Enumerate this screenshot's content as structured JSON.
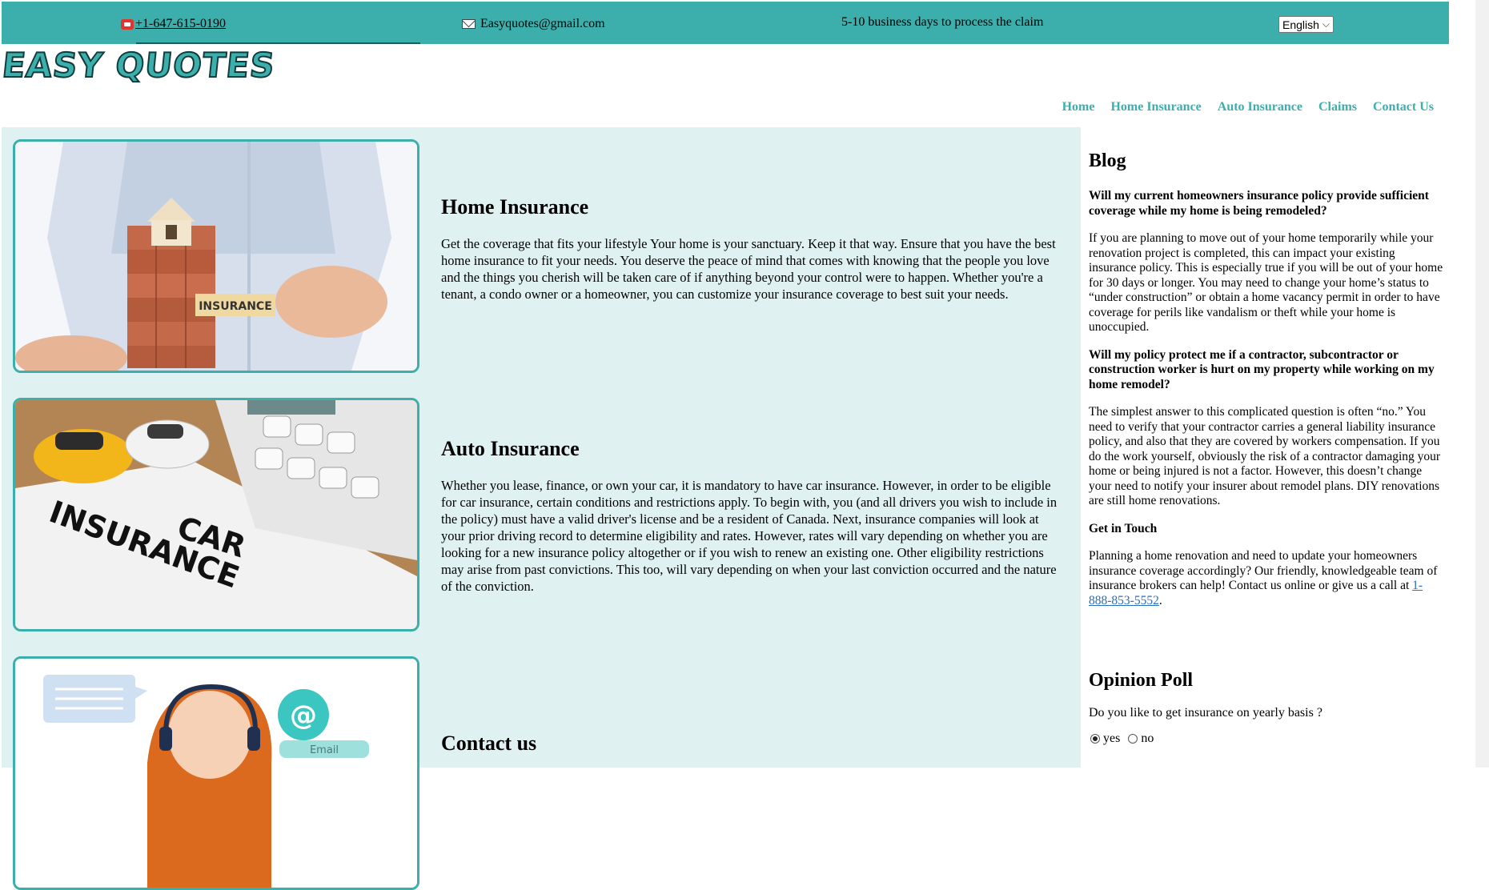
{
  "topbar": {
    "phone": "+1-647-615-0190",
    "email": "Easyquotes@gmail.com",
    "process_note": "5-10 business days to process the claim",
    "language_selected": "English",
    "background_color": "#3cafac"
  },
  "logo": {
    "text": "EASY QUOTES"
  },
  "nav": {
    "items": [
      "Home",
      "Home Insurance",
      "Auto Insurance",
      "Claims",
      "Contact Us"
    ],
    "link_color": "#3cafac"
  },
  "sections": [
    {
      "title": "Home Insurance",
      "body": "Get the coverage that fits your lifestyle Your home is your sanctuary. Keep it that way. Ensure that you have the best home insurance to fit your needs. You deserve the peace of mind that comes with knowing that the people you love and the things you cherish will be taken care of if anything beyond your control were to happen. Whether you're a tenant, a condo owner or a homeowner, you can customize your insurance coverage to best suit your needs.",
      "image_label": "INSURANCE"
    },
    {
      "title": "Auto Insurance",
      "body": "Whether you lease, finance, or own your car, it is mandatory to have car insurance. However, in order to be eligible for car insurance, certain conditions and restrictions apply. To begin with, you (and all drivers you wish to include in the policy) must have a valid driver's license and be a resident of Canada. Next, insurance companies will look at your prior driving record to determine eligibility and rates. However, rates will vary depending on whether you are looking for a new insurance policy altogether or if you wish to renew an existing one. Other eligibility restrictions may arise from past convictions. This too, will vary depending on when your last conviction occurred and the nature of the conviction.",
      "image_label_line1": "CAR",
      "image_label_line2": "INSURANCE"
    },
    {
      "title": "Contact us",
      "image_label": "Email"
    }
  ],
  "sidebar": {
    "blog_title": "Blog",
    "q1": "Will my current homeowners insurance policy provide sufficient coverage while my home is being remodeled?",
    "a1": "If you are planning to move out of your home temporarily while your renovation project is completed, this can impact your existing insurance policy. This is especially true if you will be out of your home for 30 days or longer. You may need to change your home’s status to “under construction” or obtain a home vacancy permit in order to have coverage for perils like vandalism or theft while your home is unoccupied.",
    "q2": "Will my policy protect me if a contractor, subcontractor or construction worker is hurt on my property while working on my home remodel?",
    "a2": "The simplest answer to this complicated question is often “no.” You need to verify that your contractor carries a general liability insurance policy, and also that they are covered by workers compensation. If you do the work yourself, obviously the risk of a contractor damaging your home or being injured is not a factor. However, this doesn’t change your need to notify your insurer about remodel plans. DIY renovations are still home renovations.",
    "get_in_touch": "Get in Touch",
    "touch_text": "Planning a home renovation and need to update your homeowners insurance coverage accordingly? Our friendly, knowledgeable team of insurance brokers can help! Contact us online or give us a call at",
    "touch_phone": "1-888-853-5552",
    "touch_end": "."
  },
  "poll": {
    "title": "Opinion Poll",
    "question": "Do you like to get insurance on yearly basis ?",
    "options": [
      "yes",
      "no"
    ],
    "selected": "yes"
  }
}
